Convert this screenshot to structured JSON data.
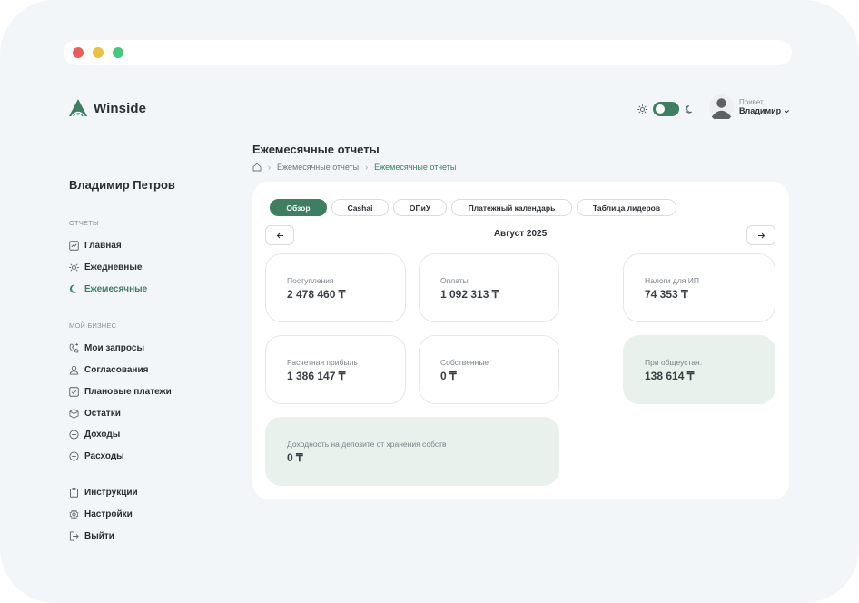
{
  "brand": {
    "name": "Winside",
    "accent": "#3e7e63"
  },
  "header": {
    "greeting": "Привет,",
    "user_name": "Владимир"
  },
  "sidebar": {
    "full_name": "Владимир Петров",
    "sections": [
      {
        "label": "ОТЧЕТЫ",
        "items": [
          {
            "label": "Главная",
            "icon": "chart-check-icon"
          },
          {
            "label": "Ежедневные",
            "icon": "sun-icon"
          },
          {
            "label": "Ежемесячные",
            "icon": "moon-icon",
            "active": true
          }
        ]
      },
      {
        "label": "МОЙ БИЗНЕС",
        "items": [
          {
            "label": "Мои запросы",
            "icon": "phone-icon"
          },
          {
            "label": "Согласования",
            "icon": "user-icon"
          },
          {
            "label": "Плановые платежи",
            "icon": "checkbox-icon"
          },
          {
            "label": "Остатки",
            "icon": "box-icon"
          },
          {
            "label": "Доходы",
            "icon": "plus-circle-icon"
          },
          {
            "label": "Расходы",
            "icon": "minus-circle-icon"
          }
        ]
      },
      {
        "label": "",
        "items": [
          {
            "label": "Инструкции",
            "icon": "clipboard-icon"
          },
          {
            "label": "Настройки",
            "icon": "gear-icon"
          },
          {
            "label": "Выйти",
            "icon": "logout-icon"
          }
        ]
      }
    ]
  },
  "main": {
    "title": "Ежемесячные отчеты",
    "breadcrumb": [
      "Ежемесячные отчеты",
      "Ежемесячные отчеты"
    ],
    "tabs": [
      "Обзор",
      "Cashai",
      "ОПиУ",
      "Платежный календарь",
      "Таблица лидеров"
    ],
    "active_tab": "Обзор",
    "month": "Август 2025",
    "stats": [
      {
        "label": "Поступления",
        "value": "2 478 460 ₸"
      },
      {
        "label": "Оплаты",
        "value": "1 092 313 ₸"
      },
      {
        "label": "Налоги для ИП",
        "value": "74 353 ₸"
      },
      {
        "label": "Расчетная прибыль",
        "value": "1 386 147 ₸"
      },
      {
        "label": "Собственные",
        "value": "0 ₸"
      },
      {
        "label": "При общеустан.",
        "value": "138 614 ₸"
      },
      {
        "label": "Доходность на депозите от хранения собств",
        "value": "0 ₸"
      }
    ]
  }
}
